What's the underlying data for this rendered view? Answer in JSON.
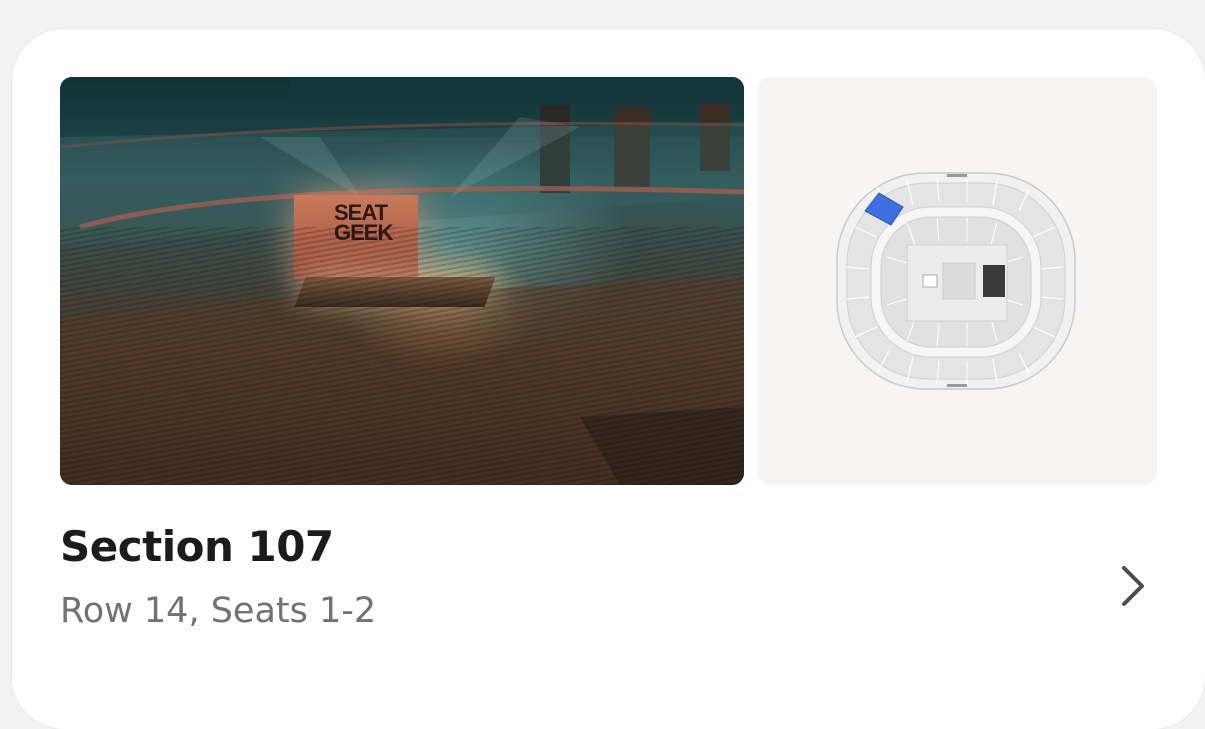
{
  "listing": {
    "section_title": "Section 107",
    "row_seats": "Row 14, Seats 1-2"
  },
  "photo": {
    "description_icon": "arena-view-image",
    "screen_logo_line1": "SEAT",
    "screen_logo_line2": "GEEK"
  },
  "seat_map": {
    "highlight_color": "#3d6fe0",
    "icon": "seat-map-image"
  },
  "actions": {
    "open_icon": "chevron-right-icon"
  }
}
